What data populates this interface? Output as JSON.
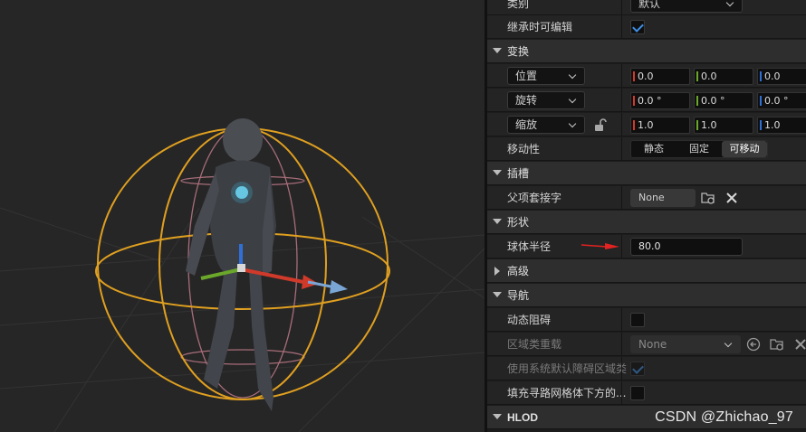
{
  "viewport": {
    "label": ""
  },
  "rows": {
    "category": {
      "label": "类别",
      "value": "默认"
    },
    "inherit_editable": {
      "label": "继承时可编辑",
      "checked": true
    },
    "transform": {
      "title": "变换"
    },
    "location": {
      "label": "位置",
      "x": "0.0",
      "y": "0.0",
      "z": "0.0"
    },
    "rotation": {
      "label": "旋转",
      "x": "0.0 °",
      "y": "0.0 °",
      "z": "0.0 °"
    },
    "scale": {
      "label": "缩放",
      "x": "1.0",
      "y": "1.0",
      "z": "1.0"
    },
    "mobility": {
      "label": "移动性",
      "options": [
        "静态",
        "固定",
        "可移动"
      ],
      "selected": "可移动"
    },
    "sockets": {
      "title": "插槽"
    },
    "parent_socket": {
      "label": "父项套接字",
      "value": "None"
    },
    "shape": {
      "title": "形状"
    },
    "sphere_radius": {
      "label": "球体半径",
      "value": "80.0"
    },
    "advanced": {
      "title": "高级"
    },
    "navigation": {
      "title": "导航"
    },
    "dynamic_obstacle": {
      "label": "动态阻碍",
      "checked": false
    },
    "area_class_override": {
      "label": "区域类重载",
      "value": "None"
    },
    "use_default_area": {
      "label": "使用系统默认障碍区域类",
      "checked": true
    },
    "fill_nav_below": {
      "label": "填充寻路网格体下方的...",
      "checked": false
    },
    "hlod": {
      "title": "HLOD"
    }
  },
  "watermark": "CSDN @Zhichao_97",
  "colors": {
    "accent": "#3d8ee6",
    "axis_x": "#d03a2a",
    "axis_y": "#6aa72a",
    "axis_z": "#2f6fd6",
    "sphere": "#e0a020",
    "capsule": "#b07080"
  }
}
